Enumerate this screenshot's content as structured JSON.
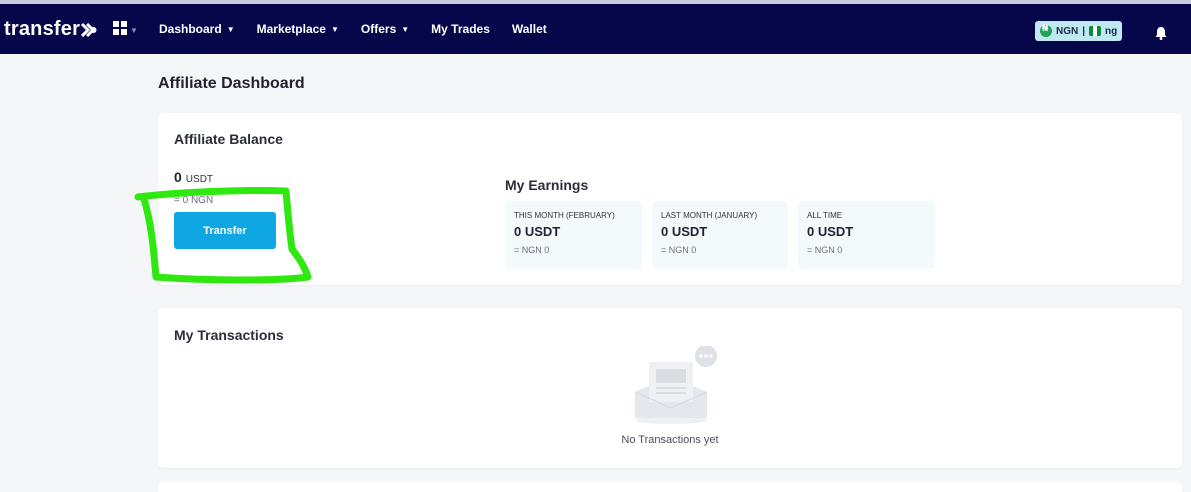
{
  "topbar": {
    "logo": "transfer",
    "nav": [
      {
        "label": "Dashboard",
        "has_dropdown": true
      },
      {
        "label": "Marketplace",
        "has_dropdown": true
      },
      {
        "label": "Offers",
        "has_dropdown": true
      },
      {
        "label": "My Trades",
        "has_dropdown": false
      },
      {
        "label": "Wallet",
        "has_dropdown": false
      }
    ],
    "currency": {
      "code": "NGN",
      "separator": "|",
      "locale": "ng"
    },
    "icons": {
      "apps": "grid-icon",
      "notifications": "bell-icon"
    }
  },
  "page": {
    "title": "Affiliate Dashboard"
  },
  "balance": {
    "heading": "Affiliate Balance",
    "amount": "0",
    "unit": "USDT",
    "ngn_equiv": "= 0 NGN",
    "transfer_label": "Transfer"
  },
  "earnings": {
    "heading": "My Earnings",
    "items": [
      {
        "label": "THIS MONTH (FEBRUARY)",
        "value": "0 USDT",
        "sub": "= NGN 0"
      },
      {
        "label": "LAST MONTH (JANUARY)",
        "value": "0 USDT",
        "sub": "= NGN 0"
      },
      {
        "label": "ALL TIME",
        "value": "0 USDT",
        "sub": "= NGN 0"
      }
    ]
  },
  "transactions": {
    "heading": "My Transactions",
    "empty_text": "No Transactions yet"
  },
  "colors": {
    "topbar": "#06064a",
    "accent": "#0ea7e3",
    "highlight": "#2ee80f",
    "earning_box": "#f2fafc"
  }
}
